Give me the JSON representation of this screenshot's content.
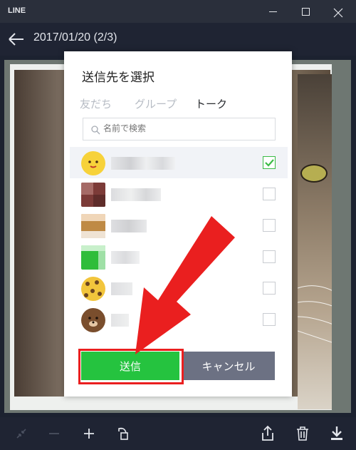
{
  "window": {
    "title": "LINE",
    "controls": [
      "minimize",
      "maximize",
      "close"
    ]
  },
  "header": {
    "title": "2017/01/20 (2/3)",
    "back_icon": "back-arrow-icon"
  },
  "dialog": {
    "title": "送信先を選択",
    "tabs": [
      {
        "label": "友だち",
        "active": false
      },
      {
        "label": "グループ",
        "active": false
      },
      {
        "label": "トーク",
        "active": true
      }
    ],
    "search": {
      "placeholder": "名前で検索",
      "value": ""
    },
    "contacts": [
      {
        "checked": true,
        "avatar_color": "#f7d23a"
      },
      {
        "checked": false,
        "avatar_color": "#7c3b38"
      },
      {
        "checked": false,
        "avatar_color": "#bf8a45"
      },
      {
        "checked": false,
        "avatar_color": "#2fbd3a"
      },
      {
        "checked": false,
        "avatar_color": "#f2c53c"
      },
      {
        "checked": false,
        "avatar_color": "#7a4e2d"
      }
    ],
    "send_label": "送信",
    "cancel_label": "キャンセル"
  },
  "toolbar": {
    "left_icons": [
      "shrink-icon",
      "zoom-out-icon",
      "zoom-in-icon",
      "rotate-icon"
    ],
    "right_icons": [
      "share-icon",
      "delete-icon",
      "download-icon"
    ]
  },
  "colors": {
    "accent_green": "#25c33f",
    "cancel_gray": "#6c7183",
    "annotation_red": "#ea1f1f"
  }
}
